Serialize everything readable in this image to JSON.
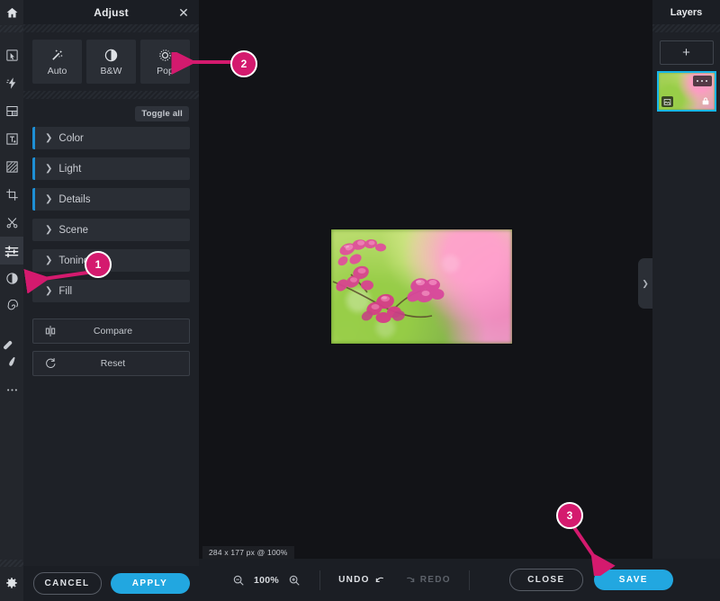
{
  "app": {
    "accent_blue": "#22a7e0",
    "accent_pink": "#d41a6e",
    "layer_select": "#18b6e8"
  },
  "toolbar": {
    "items": [
      {
        "name": "home-icon",
        "label": "Home"
      },
      {
        "name": "cursor-select-icon",
        "label": "Select"
      },
      {
        "name": "lightning-effects-icon",
        "label": "Effects"
      },
      {
        "name": "frame-layout-icon",
        "label": "Frames"
      },
      {
        "name": "text-tool-icon",
        "label": "Text"
      },
      {
        "name": "pattern-fill-icon",
        "label": "Pattern"
      },
      {
        "name": "crop-icon",
        "label": "Crop"
      },
      {
        "name": "cutout-scissors-icon",
        "label": "Cutout"
      },
      {
        "name": "adjust-sliders-icon",
        "label": "Adjust"
      },
      {
        "name": "contrast-icon",
        "label": "Contrast"
      },
      {
        "name": "liquify-spiral-icon",
        "label": "Liquify"
      },
      {
        "name": "heal-bandage-icon",
        "label": "Heal"
      },
      {
        "name": "brush-icon",
        "label": "Brush"
      },
      {
        "name": "more-options-icon",
        "label": "More"
      },
      {
        "name": "settings-gear-icon",
        "label": "Settings"
      }
    ]
  },
  "panel": {
    "title": "Adjust",
    "close_label": "✕",
    "presets": [
      {
        "label": "Auto",
        "icon": "magic-wand-icon"
      },
      {
        "label": "B&W",
        "icon": "half-circle-icon"
      },
      {
        "label": "Pop",
        "icon": "gear-burst-icon"
      }
    ],
    "toggle_all_label": "Toggle all",
    "sections": [
      {
        "label": "Color",
        "active": true
      },
      {
        "label": "Light",
        "active": true
      },
      {
        "label": "Details",
        "active": true
      },
      {
        "label": "Scene",
        "active": false
      },
      {
        "label": "Toning",
        "active": false
      },
      {
        "label": "Fill",
        "active": false
      }
    ],
    "actions": [
      {
        "label": "Compare",
        "icon": "compare-split-icon"
      },
      {
        "label": "Reset",
        "icon": "reset-refresh-icon"
      }
    ],
    "cancel_label": "CANCEL",
    "apply_label": "APPLY"
  },
  "canvas": {
    "image_info": "284 x 177 px @ 100%",
    "handle_icon": "chevron-right-icon"
  },
  "layers": {
    "title": "Layers",
    "add_label": "+",
    "layer": {
      "menu_icon": "more-dots-icon",
      "type_icon": "image-layer-icon",
      "lock_icon": "lock-icon"
    }
  },
  "bottombar": {
    "zoom_out_icon": "zoom-out-icon",
    "zoom_level": "100%",
    "zoom_in_icon": "zoom-in-icon",
    "undo_label": "UNDO",
    "redo_label": "REDO",
    "close_label": "CLOSE",
    "save_label": "SAVE"
  },
  "annotations": {
    "markers": [
      {
        "number": "1",
        "target": "adjust-sliders-icon"
      },
      {
        "number": "2",
        "target": "pop-preset-button"
      },
      {
        "number": "3",
        "target": "save-button"
      }
    ]
  }
}
